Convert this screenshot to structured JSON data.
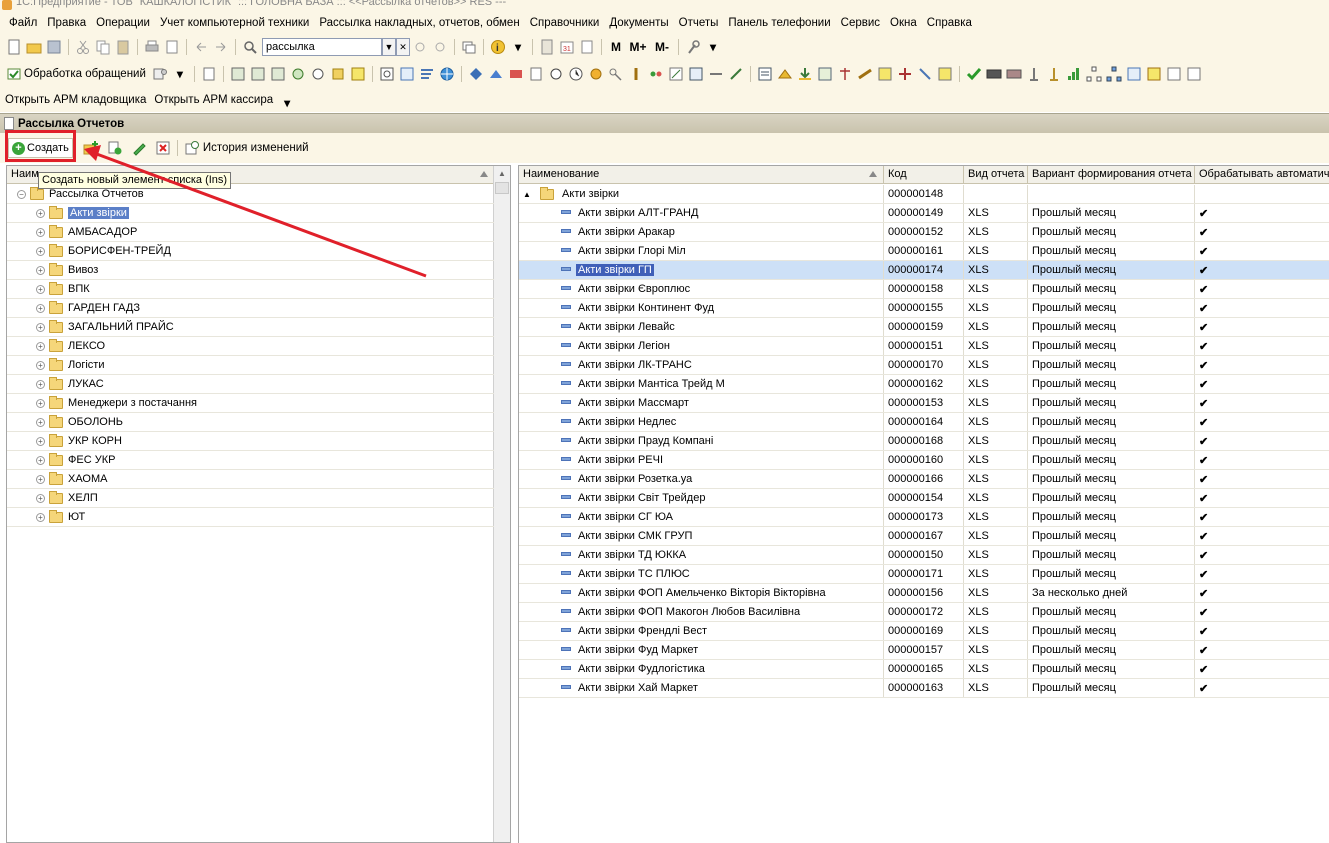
{
  "window": {
    "title": "1С:Предприятие - ТОВ \"КАШКАЛОГІСТИК\" ::: ГОЛОВНА БАЗА ::: <<Рассылка отчетов>> RES ---"
  },
  "menu": [
    "Файл",
    "Правка",
    "Операции",
    "Учет компьютерной техники",
    "Рассылка накладных, отчетов, обмен",
    "Справочники",
    "Документы",
    "Отчеты",
    "Панель телефонии",
    "Сервис",
    "Окна",
    "Справка"
  ],
  "toolbar": {
    "search_value": "рассылка",
    "m_buttons": [
      "M",
      "M+",
      "M-"
    ],
    "processing_label": "Обработка обращений",
    "open_storekeeper": "Открыть АРМ кладовщика",
    "open_cashier": "Открыть АРМ кассира"
  },
  "doc_tab": {
    "title": "Рассылка Отчетов"
  },
  "form": {
    "create_label": "Создать",
    "history_label": "История изменений",
    "tooltip": "Создать новый элемент списка (Ins)"
  },
  "tree": {
    "header": "Наименование",
    "header_visible": "Наим",
    "root": "Рассылка Отчетов",
    "items": [
      "Акти звірки",
      "АМБАСАДОР",
      "БОРИСФЕН-ТРЕЙД",
      "Вивоз",
      "ВПК",
      "ГАРДЕН ГАДЗ",
      "ЗАГАЛЬНИЙ ПРАЙС",
      "ЛЕКСО",
      "Логісти",
      "ЛУКАС",
      "Менеджери з постачання",
      "ОБОЛОНЬ",
      "УКР КОРН",
      "ФЕС УКР",
      "ХАОМА",
      "ХЕЛП",
      "ЮТ"
    ],
    "selected_index": 0
  },
  "list": {
    "columns": [
      "Наименование",
      "Код",
      "Вид отчета",
      "Вариант формирования отчета",
      "Обрабатывать автоматич"
    ],
    "group": {
      "name": "Акти звірки",
      "code": "000000148"
    },
    "selected_index": 3,
    "rows": [
      {
        "name": "Акти звірки АЛТ-ГРАНД",
        "code": "000000149",
        "type": "XLS",
        "variant": "Прошлый месяц",
        "auto": "✔"
      },
      {
        "name": "Акти звірки Аракар",
        "code": "000000152",
        "type": "XLS",
        "variant": "Прошлый месяц",
        "auto": "✔"
      },
      {
        "name": "Акти звірки Глорі Міл",
        "code": "000000161",
        "type": "XLS",
        "variant": "Прошлый месяц",
        "auto": "✔"
      },
      {
        "name": "Акти звірки ГП",
        "code": "000000174",
        "type": "XLS",
        "variant": "Прошлый месяц",
        "auto": "✔"
      },
      {
        "name": "Акти звірки Європлюс",
        "code": "000000158",
        "type": "XLS",
        "variant": "Прошлый месяц",
        "auto": "✔"
      },
      {
        "name": "Акти звірки Континент Фуд",
        "code": "000000155",
        "type": "XLS",
        "variant": "Прошлый месяц",
        "auto": "✔"
      },
      {
        "name": "Акти звірки Левайс",
        "code": "000000159",
        "type": "XLS",
        "variant": "Прошлый месяц",
        "auto": "✔"
      },
      {
        "name": "Акти звірки Легіон",
        "code": "000000151",
        "type": "XLS",
        "variant": "Прошлый месяц",
        "auto": "✔"
      },
      {
        "name": "Акти звірки ЛК-ТРАНС",
        "code": "000000170",
        "type": "XLS",
        "variant": "Прошлый месяц",
        "auto": "✔"
      },
      {
        "name": "Акти звірки Мантіса Трейд М",
        "code": "000000162",
        "type": "XLS",
        "variant": "Прошлый месяц",
        "auto": "✔"
      },
      {
        "name": "Акти звірки Массмарт",
        "code": "000000153",
        "type": "XLS",
        "variant": "Прошлый месяц",
        "auto": "✔"
      },
      {
        "name": "Акти звірки Недлес",
        "code": "000000164",
        "type": "XLS",
        "variant": "Прошлый месяц",
        "auto": "✔"
      },
      {
        "name": "Акти звірки Прауд Компані",
        "code": "000000168",
        "type": "XLS",
        "variant": "Прошлый месяц",
        "auto": "✔"
      },
      {
        "name": "Акти звірки РЕЧІ",
        "code": "000000160",
        "type": "XLS",
        "variant": "Прошлый месяц",
        "auto": "✔"
      },
      {
        "name": "Акти звірки Розетка.уа",
        "code": "000000166",
        "type": "XLS",
        "variant": "Прошлый месяц",
        "auto": "✔"
      },
      {
        "name": "Акти звірки Світ Трейдер",
        "code": "000000154",
        "type": "XLS",
        "variant": "Прошлый месяц",
        "auto": "✔"
      },
      {
        "name": "Акти звірки СГ ЮА",
        "code": "000000173",
        "type": "XLS",
        "variant": "Прошлый месяц",
        "auto": "✔"
      },
      {
        "name": "Акти звірки СМК ГРУП",
        "code": "000000167",
        "type": "XLS",
        "variant": "Прошлый месяц",
        "auto": "✔"
      },
      {
        "name": "Акти звірки ТД ЮККА",
        "code": "000000150",
        "type": "XLS",
        "variant": "Прошлый месяц",
        "auto": "✔"
      },
      {
        "name": "Акти звірки ТС ПЛЮС",
        "code": "000000171",
        "type": "XLS",
        "variant": "Прошлый месяц",
        "auto": "✔"
      },
      {
        "name": "Акти звірки ФОП Амельченко Вікторія Вікторівна",
        "code": "000000156",
        "type": "XLS",
        "variant": "За несколько дней",
        "auto": "✔"
      },
      {
        "name": "Акти звірки ФОП Макогон Любов Василівна",
        "code": "000000172",
        "type": "XLS",
        "variant": "Прошлый месяц",
        "auto": "✔"
      },
      {
        "name": "Акти звірки Френдлі Вест",
        "code": "000000169",
        "type": "XLS",
        "variant": "Прошлый месяц",
        "auto": "✔"
      },
      {
        "name": "Акти звірки Фуд Маркет",
        "code": "000000157",
        "type": "XLS",
        "variant": "Прошлый месяц",
        "auto": "✔"
      },
      {
        "name": "Акти звірки Фудлогістика",
        "code": "000000165",
        "type": "XLS",
        "variant": "Прошлый месяц",
        "auto": "✔"
      },
      {
        "name": "Акти звірки Хай Маркет",
        "code": "000000163",
        "type": "XLS",
        "variant": "Прошлый месяц",
        "auto": "✔"
      }
    ]
  },
  "colors": {
    "chrome_bg": "#fbf6e6",
    "selection": "#3f5fb8",
    "annotation": "#e0202a"
  }
}
